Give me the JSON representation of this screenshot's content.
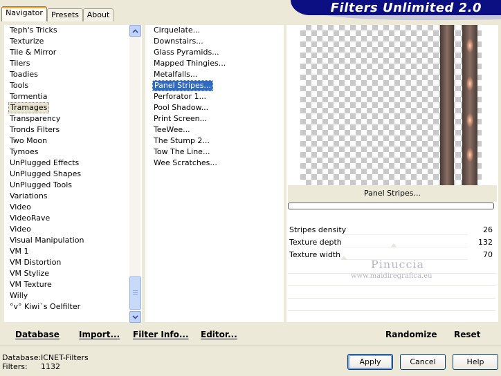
{
  "tabs": [
    {
      "label": "Navigator",
      "active": true
    },
    {
      "label": "Presets",
      "active": false
    },
    {
      "label": "About",
      "active": false
    }
  ],
  "banner": {
    "title": "Filters Unlimited 2.0"
  },
  "categories": [
    "Teph's Tricks",
    "Texturize",
    "Tile & Mirror",
    "Tilers",
    "Toadies",
    "Tools",
    "Tormentia",
    "Tramages",
    "Transparency",
    "Tronds Filters",
    "Two Moon",
    "Tymoes",
    "UnPlugged Effects",
    "UnPlugged Shapes",
    "UnPlugged Tools",
    "Variations",
    "Video",
    "VideoRave",
    "Video",
    "Visual Manipulation",
    "VM 1",
    "VM Distortion",
    "VM Stylize",
    "VM Texture",
    "Willy",
    "°v° Kiwi`s Oelfilter"
  ],
  "selected_category": "Tramages",
  "filters": [
    "Cirquelate...",
    "Downstairs...",
    "Glass Pyramids...",
    "Mapped Thingies...",
    "Metalfalls...",
    "Panel Stripes...",
    "Perforator 1...",
    "Pool Shadow...",
    "Print Screen...",
    "TeeWee...",
    "The Stump 2...",
    "Tow The Line...",
    "Wee Scratches..."
  ],
  "selected_filter": "Panel Stripes...",
  "effect_name": "Panel Stripes...",
  "params": [
    {
      "label": "Stripes density",
      "value": "26"
    },
    {
      "label": "Texture depth",
      "value": "132"
    },
    {
      "label": "Texture width",
      "value": "70"
    }
  ],
  "watermark": {
    "line1": "Pinuccia",
    "line2": "www.maidiregrafica.eu"
  },
  "bottom_buttons": {
    "database": "Database",
    "import": "Import...",
    "filter_info": "Filter Info...",
    "editor": "Editor...",
    "randomize": "Randomize",
    "reset": "Reset"
  },
  "status": {
    "database_label": "Database:",
    "database_value": "ICNET-Filters",
    "filters_label": "Filters:",
    "filters_value": "1132"
  },
  "dialog_buttons": {
    "apply": "Apply",
    "cancel": "Cancel",
    "help": "Help"
  },
  "colors": {
    "banner": "#0b0f82",
    "selection": "#316ac5",
    "window": "#ece9d8"
  }
}
